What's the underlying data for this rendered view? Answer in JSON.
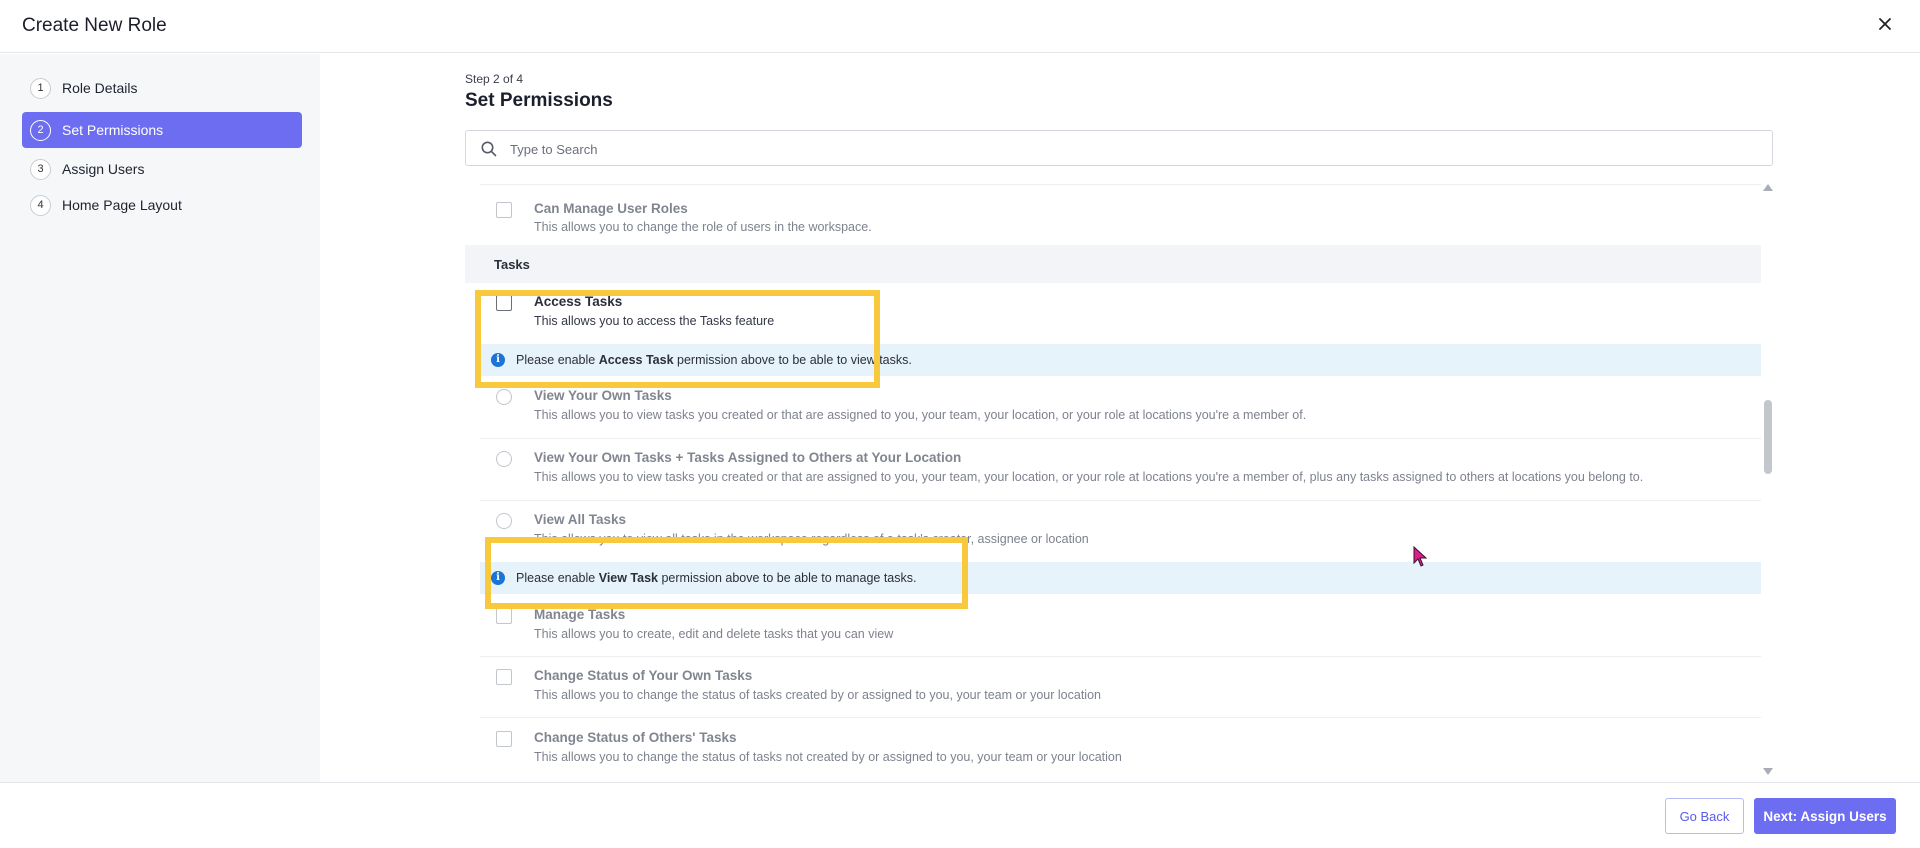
{
  "header": {
    "title": "Create New Role",
    "close_icon": "close-icon"
  },
  "sidebar": {
    "steps": [
      {
        "num": "1",
        "label": "Role Details",
        "active": false
      },
      {
        "num": "2",
        "label": "Set Permissions",
        "active": true
      },
      {
        "num": "3",
        "label": "Assign Users",
        "active": false
      },
      {
        "num": "4",
        "label": "Home Page Layout",
        "active": false
      }
    ]
  },
  "main": {
    "step_count": "Step 2 of 4",
    "title": "Set Permissions",
    "search": {
      "placeholder": "Type to Search",
      "icon": "search-icon"
    },
    "permissions": {
      "prev": {
        "name": "Can Manage User Roles",
        "desc": "This allows you to change the role of users in the workspace."
      },
      "section": "Tasks",
      "access_tasks": {
        "name": "Access Tasks",
        "desc": "This allows you to access the Tasks feature"
      },
      "info1": {
        "prefix": "Please enable ",
        "bold": "Access Task",
        "suffix": " permission above to be able to view tasks."
      },
      "view_own": {
        "name": "View Your Own Tasks",
        "desc": "This allows you to view tasks you created or that are assigned to you, your team, your location, or your role at locations you're a member of."
      },
      "view_own_location": {
        "name": "View Your Own Tasks + Tasks Assigned to Others at Your Location",
        "desc": "This allows you to view tasks you created or that are assigned to you, your team, your location, or your role at locations you're a member of, plus any tasks assigned to others at locations you belong to."
      },
      "view_all": {
        "name": "View All Tasks",
        "desc": "This allows you to view all tasks in the workspace regardless of a task's creator, assignee or location"
      },
      "info2": {
        "prefix": "Please enable ",
        "bold": "View Task",
        "suffix": " permission above to be able to manage tasks."
      },
      "manage": {
        "name": "Manage Tasks",
        "desc": "This allows you to create, edit and delete tasks that you can view"
      },
      "status_own": {
        "name": "Change Status of Your Own Tasks",
        "desc": "This allows you to change the status of tasks created by or assigned to you, your team or your location"
      },
      "status_others": {
        "name": "Change Status of Others' Tasks",
        "desc": "This allows you to change the status of tasks not created by or assigned to you, your team or your location"
      }
    }
  },
  "footer": {
    "back_label": "Go Back",
    "next_label": "Next: Assign Users"
  },
  "colors": {
    "accent": "#6c6df1",
    "highlight": "#f8c93c",
    "info_bg": "#e6f3fb",
    "info_icon": "#1b74d6"
  }
}
